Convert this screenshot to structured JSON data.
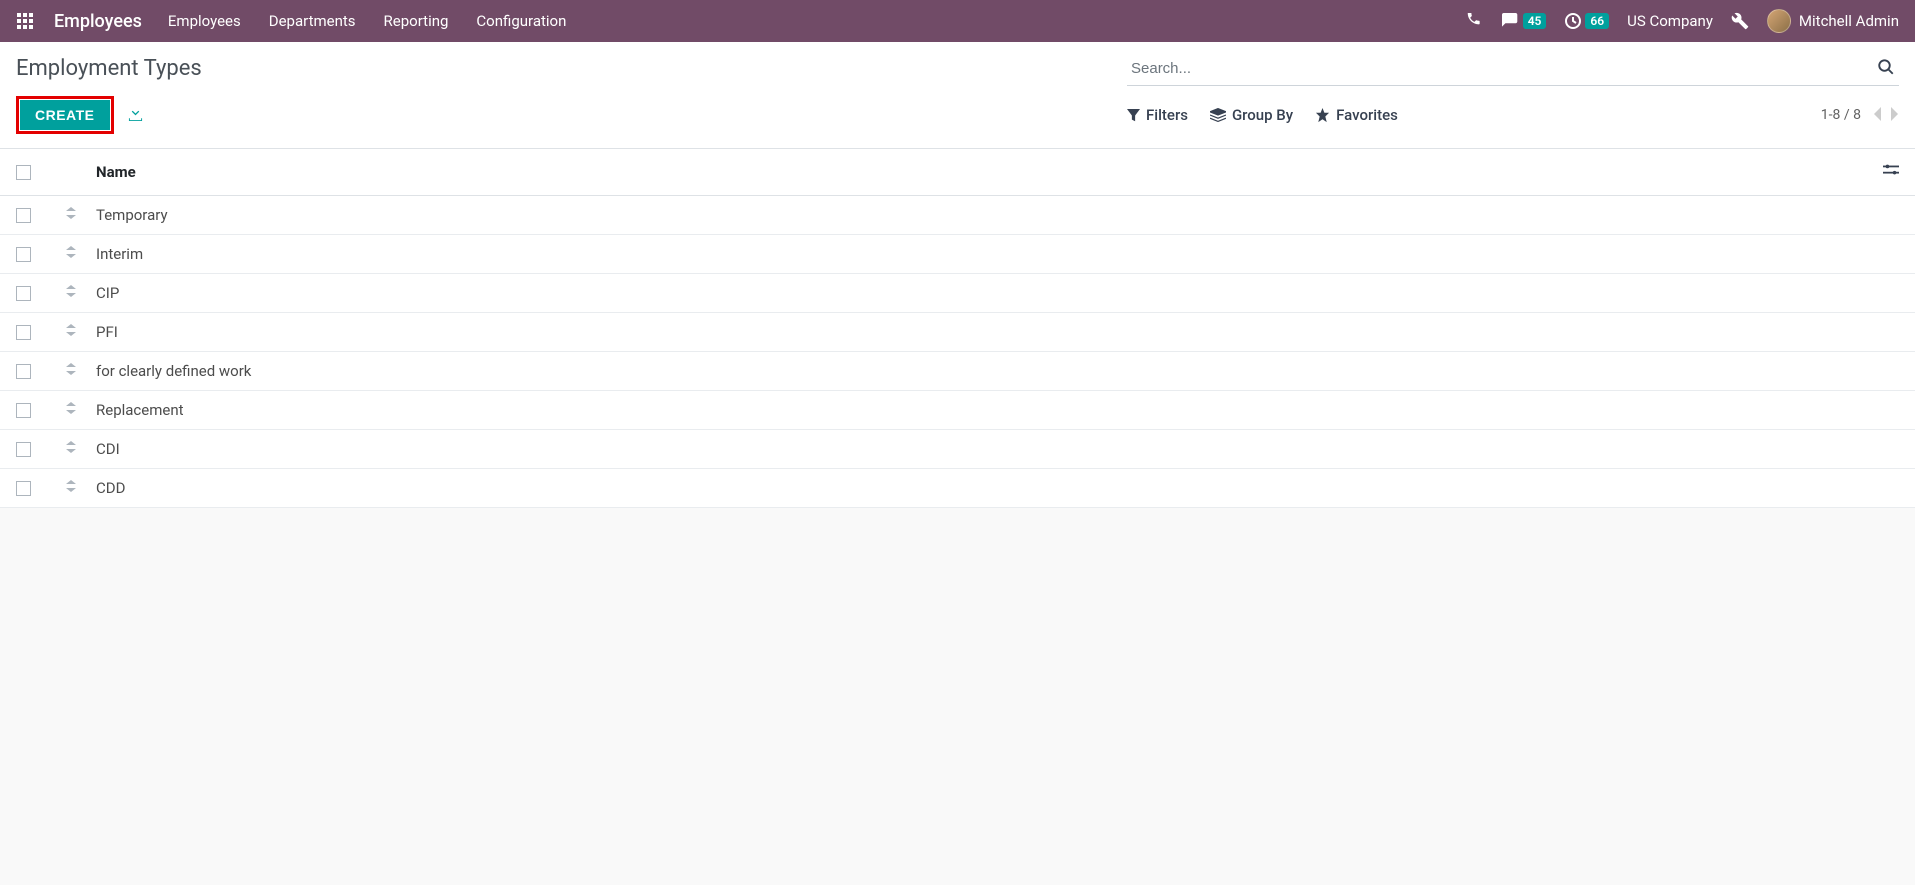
{
  "navbar": {
    "brand": "Employees",
    "menu": [
      "Employees",
      "Departments",
      "Reporting",
      "Configuration"
    ],
    "messages_count": "45",
    "activities_count": "66",
    "company": "US Company",
    "username": "Mitchell Admin"
  },
  "page": {
    "title": "Employment Types",
    "create_label": "CREATE",
    "search_placeholder": "Search..."
  },
  "filters": {
    "filters_label": "Filters",
    "groupby_label": "Group By",
    "favorites_label": "Favorites"
  },
  "pager": {
    "text": "1-8 / 8"
  },
  "table": {
    "header_name": "Name",
    "rows": [
      {
        "name": "Temporary"
      },
      {
        "name": "Interim"
      },
      {
        "name": "CIP"
      },
      {
        "name": "PFI"
      },
      {
        "name": "for clearly defined work"
      },
      {
        "name": "Replacement"
      },
      {
        "name": "CDI"
      },
      {
        "name": "CDD"
      }
    ]
  }
}
